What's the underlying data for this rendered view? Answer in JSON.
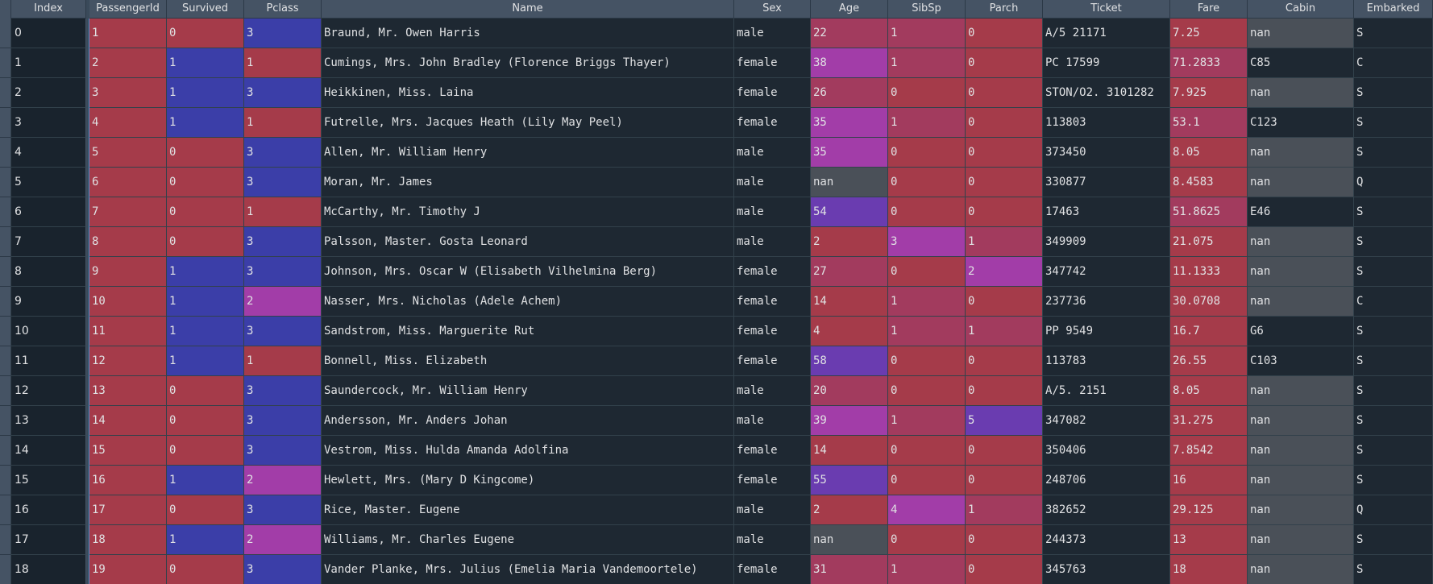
{
  "columns": [
    "Index",
    "PassengerId",
    "Survived",
    "Pclass",
    "Name",
    "Sex",
    "Age",
    "SibSp",
    "Parch",
    "Ticket",
    "Fare",
    "Cabin",
    "Embarked"
  ],
  "palette": {
    "header_bg": "#455364",
    "base_bg": "#19232d",
    "red": "#a53b4a",
    "blue": "#3b3ea8",
    "purple": "#8a3cb0",
    "magenta": "#a23da8",
    "violet": "#6a3cb0",
    "crimson": "#a23b5e",
    "gray": "#4a5058",
    "dark": "#1e2832"
  },
  "rows": [
    {
      "index": "0",
      "cells": [
        [
          "1",
          "red"
        ],
        [
          "0",
          "red"
        ],
        [
          "3",
          "blue"
        ],
        [
          "Braund, Mr. Owen Harris",
          ""
        ],
        [
          "male",
          ""
        ],
        [
          "22",
          "crimson"
        ],
        [
          "1",
          "crimson"
        ],
        [
          "0",
          "red"
        ],
        [
          "A/5 21171",
          ""
        ],
        [
          "7.25",
          "red"
        ],
        [
          "nan",
          "gray"
        ],
        [
          "S",
          ""
        ]
      ]
    },
    {
      "index": "1",
      "cells": [
        [
          "2",
          "red"
        ],
        [
          "1",
          "blue"
        ],
        [
          "1",
          "red"
        ],
        [
          "Cumings, Mrs. John Bradley (Florence Briggs Thayer)",
          ""
        ],
        [
          "female",
          ""
        ],
        [
          "38",
          "magenta"
        ],
        [
          "1",
          "crimson"
        ],
        [
          "0",
          "red"
        ],
        [
          "PC 17599",
          ""
        ],
        [
          "71.2833",
          "crimson"
        ],
        [
          "C85",
          ""
        ],
        [
          "C",
          ""
        ]
      ]
    },
    {
      "index": "2",
      "cells": [
        [
          "3",
          "red"
        ],
        [
          "1",
          "blue"
        ],
        [
          "3",
          "blue"
        ],
        [
          "Heikkinen, Miss. Laina",
          ""
        ],
        [
          "female",
          ""
        ],
        [
          "26",
          "crimson"
        ],
        [
          "0",
          "red"
        ],
        [
          "0",
          "red"
        ],
        [
          "STON/O2. 3101282",
          ""
        ],
        [
          "7.925",
          "red"
        ],
        [
          "nan",
          "gray"
        ],
        [
          "S",
          ""
        ]
      ]
    },
    {
      "index": "3",
      "cells": [
        [
          "4",
          "red"
        ],
        [
          "1",
          "blue"
        ],
        [
          "1",
          "red"
        ],
        [
          "Futrelle, Mrs. Jacques Heath (Lily May Peel)",
          ""
        ],
        [
          "female",
          ""
        ],
        [
          "35",
          "magenta"
        ],
        [
          "1",
          "crimson"
        ],
        [
          "0",
          "red"
        ],
        [
          "113803",
          ""
        ],
        [
          "53.1",
          "crimson"
        ],
        [
          "C123",
          ""
        ],
        [
          "S",
          ""
        ]
      ]
    },
    {
      "index": "4",
      "cells": [
        [
          "5",
          "red"
        ],
        [
          "0",
          "red"
        ],
        [
          "3",
          "blue"
        ],
        [
          "Allen, Mr. William Henry",
          ""
        ],
        [
          "male",
          ""
        ],
        [
          "35",
          "magenta"
        ],
        [
          "0",
          "red"
        ],
        [
          "0",
          "red"
        ],
        [
          "373450",
          ""
        ],
        [
          "8.05",
          "red"
        ],
        [
          "nan",
          "gray"
        ],
        [
          "S",
          ""
        ]
      ]
    },
    {
      "index": "5",
      "cells": [
        [
          "6",
          "red"
        ],
        [
          "0",
          "red"
        ],
        [
          "3",
          "blue"
        ],
        [
          "Moran, Mr. James",
          ""
        ],
        [
          "male",
          ""
        ],
        [
          "nan",
          "gray"
        ],
        [
          "0",
          "red"
        ],
        [
          "0",
          "red"
        ],
        [
          "330877",
          ""
        ],
        [
          "8.4583",
          "red"
        ],
        [
          "nan",
          "gray"
        ],
        [
          "Q",
          ""
        ]
      ]
    },
    {
      "index": "6",
      "cells": [
        [
          "7",
          "red"
        ],
        [
          "0",
          "red"
        ],
        [
          "1",
          "red"
        ],
        [
          "McCarthy, Mr. Timothy J",
          ""
        ],
        [
          "male",
          ""
        ],
        [
          "54",
          "violet"
        ],
        [
          "0",
          "red"
        ],
        [
          "0",
          "red"
        ],
        [
          "17463",
          ""
        ],
        [
          "51.8625",
          "crimson"
        ],
        [
          "E46",
          ""
        ],
        [
          "S",
          ""
        ]
      ]
    },
    {
      "index": "7",
      "cells": [
        [
          "8",
          "red"
        ],
        [
          "0",
          "red"
        ],
        [
          "3",
          "blue"
        ],
        [
          "Palsson, Master. Gosta Leonard",
          ""
        ],
        [
          "male",
          ""
        ],
        [
          "2",
          "red"
        ],
        [
          "3",
          "magenta"
        ],
        [
          "1",
          "crimson"
        ],
        [
          "349909",
          ""
        ],
        [
          "21.075",
          "red"
        ],
        [
          "nan",
          "gray"
        ],
        [
          "S",
          ""
        ]
      ]
    },
    {
      "index": "8",
      "cells": [
        [
          "9",
          "red"
        ],
        [
          "1",
          "blue"
        ],
        [
          "3",
          "blue"
        ],
        [
          "Johnson, Mrs. Oscar W (Elisabeth Vilhelmina Berg)",
          ""
        ],
        [
          "female",
          ""
        ],
        [
          "27",
          "crimson"
        ],
        [
          "0",
          "red"
        ],
        [
          "2",
          "magenta"
        ],
        [
          "347742",
          ""
        ],
        [
          "11.1333",
          "red"
        ],
        [
          "nan",
          "gray"
        ],
        [
          "S",
          ""
        ]
      ]
    },
    {
      "index": "9",
      "cells": [
        [
          "10",
          "red"
        ],
        [
          "1",
          "blue"
        ],
        [
          "2",
          "magenta"
        ],
        [
          "Nasser, Mrs. Nicholas (Adele Achem)",
          ""
        ],
        [
          "female",
          ""
        ],
        [
          "14",
          "red"
        ],
        [
          "1",
          "crimson"
        ],
        [
          "0",
          "red"
        ],
        [
          "237736",
          ""
        ],
        [
          "30.0708",
          "red"
        ],
        [
          "nan",
          "gray"
        ],
        [
          "C",
          ""
        ]
      ]
    },
    {
      "index": "10",
      "cells": [
        [
          "11",
          "red"
        ],
        [
          "1",
          "blue"
        ],
        [
          "3",
          "blue"
        ],
        [
          "Sandstrom, Miss. Marguerite Rut",
          ""
        ],
        [
          "female",
          ""
        ],
        [
          "4",
          "red"
        ],
        [
          "1",
          "crimson"
        ],
        [
          "1",
          "crimson"
        ],
        [
          "PP 9549",
          ""
        ],
        [
          "16.7",
          "red"
        ],
        [
          "G6",
          ""
        ],
        [
          "S",
          ""
        ]
      ]
    },
    {
      "index": "11",
      "cells": [
        [
          "12",
          "red"
        ],
        [
          "1",
          "blue"
        ],
        [
          "1",
          "red"
        ],
        [
          "Bonnell, Miss. Elizabeth",
          ""
        ],
        [
          "female",
          ""
        ],
        [
          "58",
          "violet"
        ],
        [
          "0",
          "red"
        ],
        [
          "0",
          "red"
        ],
        [
          "113783",
          ""
        ],
        [
          "26.55",
          "red"
        ],
        [
          "C103",
          ""
        ],
        [
          "S",
          ""
        ]
      ]
    },
    {
      "index": "12",
      "cells": [
        [
          "13",
          "red"
        ],
        [
          "0",
          "red"
        ],
        [
          "3",
          "blue"
        ],
        [
          "Saundercock, Mr. William Henry",
          ""
        ],
        [
          "male",
          ""
        ],
        [
          "20",
          "crimson"
        ],
        [
          "0",
          "red"
        ],
        [
          "0",
          "red"
        ],
        [
          "A/5. 2151",
          ""
        ],
        [
          "8.05",
          "red"
        ],
        [
          "nan",
          "gray"
        ],
        [
          "S",
          ""
        ]
      ]
    },
    {
      "index": "13",
      "cells": [
        [
          "14",
          "red"
        ],
        [
          "0",
          "red"
        ],
        [
          "3",
          "blue"
        ],
        [
          "Andersson, Mr. Anders Johan",
          ""
        ],
        [
          "male",
          ""
        ],
        [
          "39",
          "magenta"
        ],
        [
          "1",
          "crimson"
        ],
        [
          "5",
          "violet"
        ],
        [
          "347082",
          ""
        ],
        [
          "31.275",
          "red"
        ],
        [
          "nan",
          "gray"
        ],
        [
          "S",
          ""
        ]
      ]
    },
    {
      "index": "14",
      "cells": [
        [
          "15",
          "red"
        ],
        [
          "0",
          "red"
        ],
        [
          "3",
          "blue"
        ],
        [
          "Vestrom, Miss. Hulda Amanda Adolfina",
          ""
        ],
        [
          "female",
          ""
        ],
        [
          "14",
          "red"
        ],
        [
          "0",
          "red"
        ],
        [
          "0",
          "red"
        ],
        [
          "350406",
          ""
        ],
        [
          "7.8542",
          "red"
        ],
        [
          "nan",
          "gray"
        ],
        [
          "S",
          ""
        ]
      ]
    },
    {
      "index": "15",
      "cells": [
        [
          "16",
          "red"
        ],
        [
          "1",
          "blue"
        ],
        [
          "2",
          "magenta"
        ],
        [
          "Hewlett, Mrs. (Mary D Kingcome)",
          ""
        ],
        [
          "female",
          ""
        ],
        [
          "55",
          "violet"
        ],
        [
          "0",
          "red"
        ],
        [
          "0",
          "red"
        ],
        [
          "248706",
          ""
        ],
        [
          "16",
          "red"
        ],
        [
          "nan",
          "gray"
        ],
        [
          "S",
          ""
        ]
      ]
    },
    {
      "index": "16",
      "cells": [
        [
          "17",
          "red"
        ],
        [
          "0",
          "red"
        ],
        [
          "3",
          "blue"
        ],
        [
          "Rice, Master. Eugene",
          ""
        ],
        [
          "male",
          ""
        ],
        [
          "2",
          "red"
        ],
        [
          "4",
          "magenta"
        ],
        [
          "1",
          "crimson"
        ],
        [
          "382652",
          ""
        ],
        [
          "29.125",
          "red"
        ],
        [
          "nan",
          "gray"
        ],
        [
          "Q",
          ""
        ]
      ]
    },
    {
      "index": "17",
      "cells": [
        [
          "18",
          "red"
        ],
        [
          "1",
          "blue"
        ],
        [
          "2",
          "magenta"
        ],
        [
          "Williams, Mr. Charles Eugene",
          ""
        ],
        [
          "male",
          ""
        ],
        [
          "nan",
          "gray"
        ],
        [
          "0",
          "red"
        ],
        [
          "0",
          "red"
        ],
        [
          "244373",
          ""
        ],
        [
          "13",
          "red"
        ],
        [
          "nan",
          "gray"
        ],
        [
          "S",
          ""
        ]
      ]
    },
    {
      "index": "18",
      "cells": [
        [
          "19",
          "red"
        ],
        [
          "0",
          "red"
        ],
        [
          "3",
          "blue"
        ],
        [
          "Vander Planke, Mrs. Julius (Emelia Maria Vandemoortele)",
          ""
        ],
        [
          "female",
          ""
        ],
        [
          "31",
          "crimson"
        ],
        [
          "1",
          "crimson"
        ],
        [
          "0",
          "red"
        ],
        [
          "345763",
          ""
        ],
        [
          "18",
          "red"
        ],
        [
          "nan",
          "gray"
        ],
        [
          "S",
          ""
        ]
      ]
    }
  ]
}
